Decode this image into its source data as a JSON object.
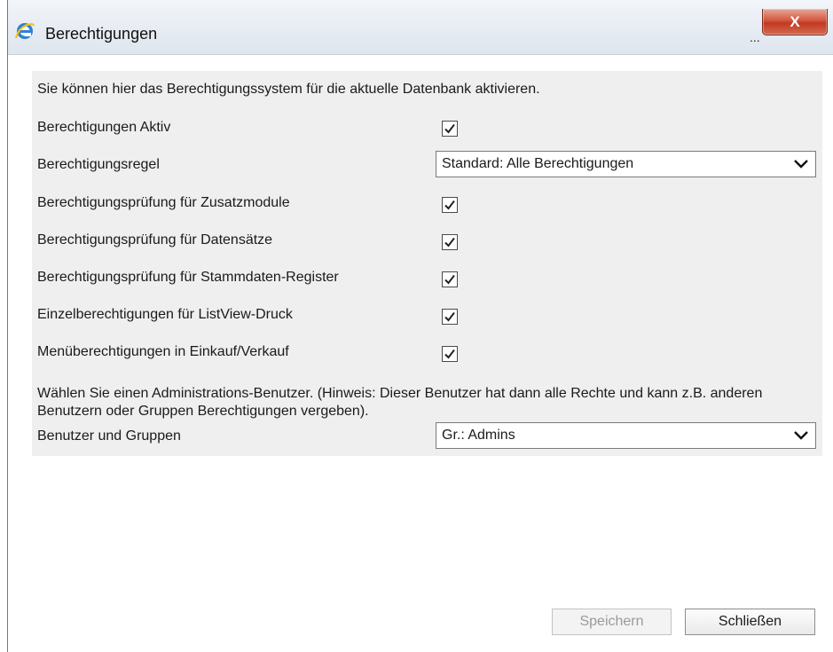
{
  "window": {
    "title": "Berechtigungen",
    "ellipsis": "...",
    "close_label": "X"
  },
  "intro_text": "Sie können hier das Berechtigungssystem für die aktuelle Datenbank aktivieren.",
  "settings": [
    {
      "label": "Berechtigungen Aktiv",
      "type": "checkbox",
      "checked": true
    },
    {
      "label": "Berechtigungsregel",
      "type": "select",
      "value": "Standard: Alle Berechtigungen"
    },
    {
      "label": "Berechtigungsprüfung für Zusatzmodule",
      "type": "checkbox",
      "checked": true
    },
    {
      "label": "Berechtigungsprüfung für Datensätze",
      "type": "checkbox",
      "checked": true
    },
    {
      "label": "Berechtigungsprüfung für Stammdaten-Register",
      "type": "checkbox",
      "checked": true
    },
    {
      "label": "Einzelberechtigungen für ListView-Druck",
      "type": "checkbox",
      "checked": true
    },
    {
      "label": "Menüberechtigungen in Einkauf/Verkauf",
      "type": "checkbox",
      "checked": true
    }
  ],
  "admin_note": "Wählen Sie einen Administrations-Benutzer. (Hinweis: Dieser Benutzer hat dann alle Rechte und kann z.B. anderen Benutzern oder Gruppen Berechtigungen vergeben).",
  "user_group": {
    "label": "Benutzer und Gruppen",
    "value": "Gr.: Admins"
  },
  "buttons": {
    "save": "Speichern",
    "close": "Schließen"
  },
  "colors": {
    "close_button": "#c9452d",
    "panel_background": "#efefef"
  }
}
